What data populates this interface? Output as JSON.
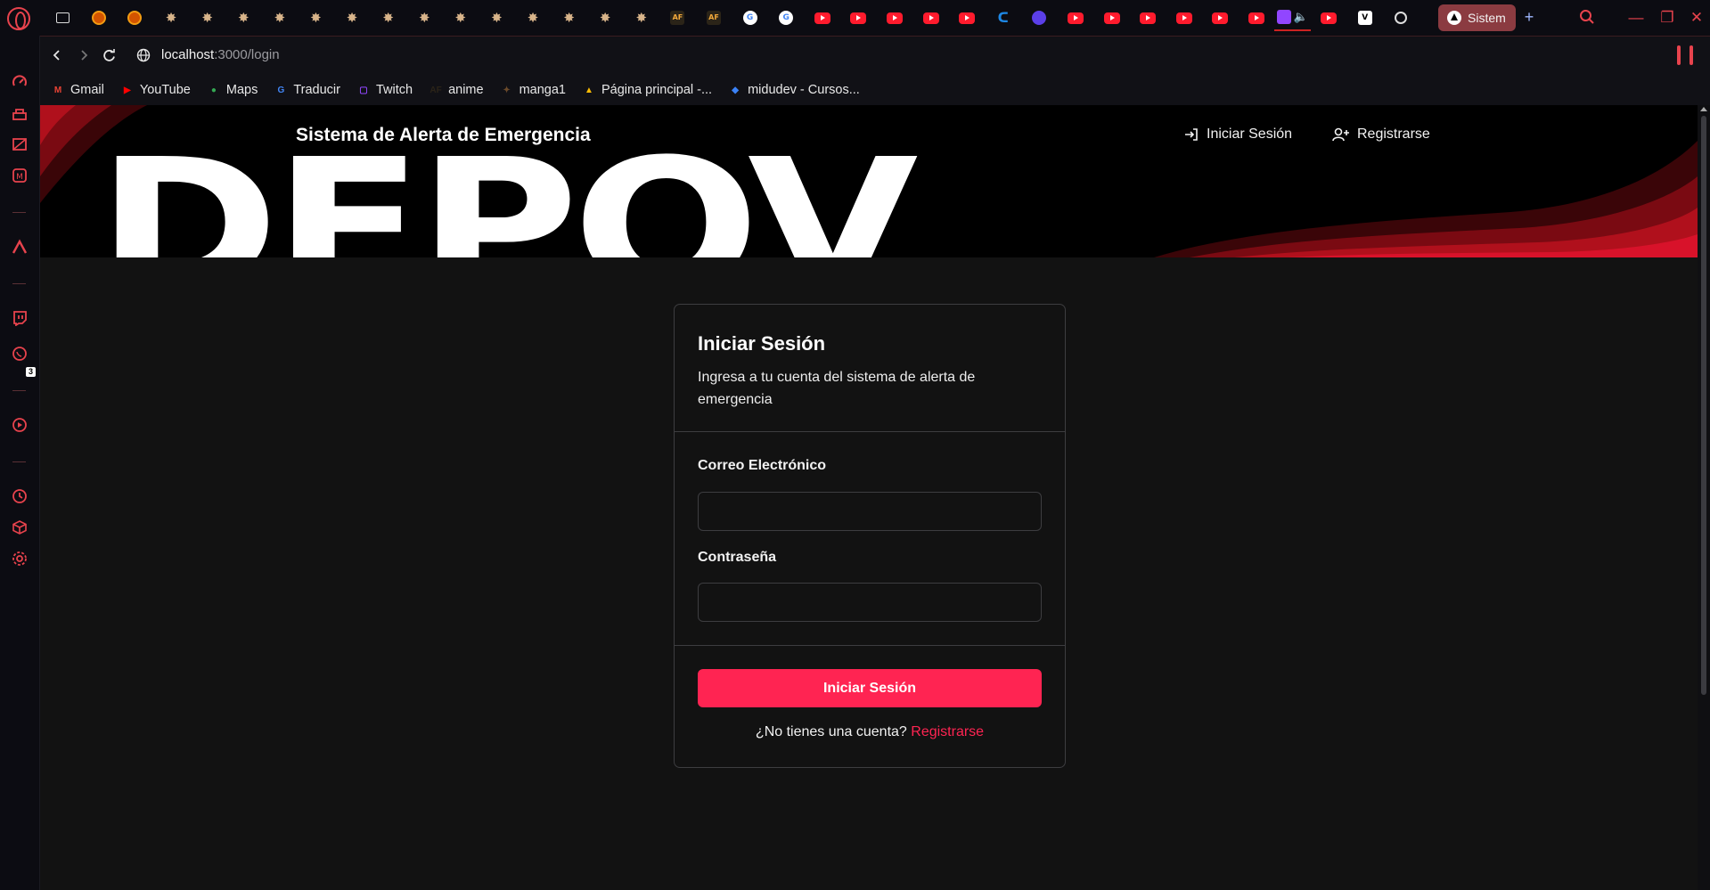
{
  "browser": {
    "active_tab_title": "Sistem",
    "new_tab_label": "+",
    "address": {
      "host": "localhost",
      "path": ":3000/login"
    },
    "bookmarks": [
      {
        "label": "Gmail",
        "icon": "gmail-icon",
        "abbr": "M",
        "color": "#ea4335"
      },
      {
        "label": "YouTube",
        "icon": "youtube-icon",
        "abbr": "▶",
        "color": "#ff0000"
      },
      {
        "label": "Maps",
        "icon": "maps-pin-icon",
        "abbr": "●",
        "color": "#34a853"
      },
      {
        "label": "Traducir",
        "icon": "translate-icon",
        "abbr": "G",
        "color": "#4285f4"
      },
      {
        "label": "Twitch",
        "icon": "twitch-icon",
        "abbr": "▢",
        "color": "#9146ff"
      },
      {
        "label": "anime",
        "icon": "af-icon",
        "abbr": "AF",
        "color": "#2b2418"
      },
      {
        "label": "manga1",
        "icon": "manga-icon",
        "abbr": "✦",
        "color": "#6b4a2a"
      },
      {
        "label": "Página principal -...",
        "icon": "google-drive-icon",
        "abbr": "▲",
        "color": "#fbbc04"
      },
      {
        "label": "midudev - Cursos...",
        "icon": "midudev-icon",
        "abbr": "◆",
        "color": "#3b82f6"
      }
    ],
    "sidebar_badge": "3",
    "colors": {
      "accent": "#e8434d",
      "tab_active": "#8b3b41"
    }
  },
  "header": {
    "subtitle": "Sistema de Alerta de Emergencia",
    "logo_text": "DEPOV",
    "nav": {
      "login": "Iniciar Sesión",
      "register": "Registrarse"
    }
  },
  "login_card": {
    "title": "Iniciar Sesión",
    "description": "Ingresa a tu cuenta del sistema de alerta de emergencia",
    "email_label": "Correo Electrónico",
    "email_value": "",
    "password_label": "Contraseña",
    "password_value": "",
    "submit_label": "Iniciar Sesión",
    "footer_text": "¿No tienes una cuenta?",
    "footer_link": "Registrarse",
    "colors": {
      "button": "#ff2452",
      "link": "#ff2452"
    }
  }
}
